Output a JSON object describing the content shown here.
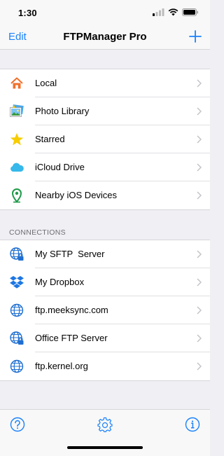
{
  "status_bar": {
    "time": "1:30"
  },
  "nav": {
    "edit_label": "Edit",
    "title": "FTPManager Pro",
    "add_icon": "plus-icon"
  },
  "locations": [
    {
      "label": "Local",
      "icon": "home-icon"
    },
    {
      "label": "Photo Library",
      "icon": "photos-icon"
    },
    {
      "label": "Starred",
      "icon": "star-icon"
    },
    {
      "label": "iCloud Drive",
      "icon": "cloud-icon"
    },
    {
      "label": "Nearby iOS Devices",
      "icon": "location-pin-icon"
    }
  ],
  "connections_header": "CONNECTIONS",
  "connections": [
    {
      "label": "My SFTP  Server",
      "icon": "globe-lock-icon"
    },
    {
      "label": "My Dropbox",
      "icon": "dropbox-icon"
    },
    {
      "label": "ftp.meeksync.com",
      "icon": "globe-icon"
    },
    {
      "label": "Office FTP Server",
      "icon": "globe-lock-icon"
    },
    {
      "label": "ftp.kernel.org",
      "icon": "globe-icon"
    }
  ],
  "tab_bar": {
    "help_icon": "help-icon",
    "settings_icon": "settings-icon",
    "info_icon": "info-icon"
  },
  "colors": {
    "accent": "#1a82fb",
    "background": "#efeff4",
    "home": "#f0712c",
    "star": "#f7cd00",
    "cloud": "#36b8ea",
    "pin": "#1f9a4a",
    "dropbox": "#1d76e2"
  }
}
